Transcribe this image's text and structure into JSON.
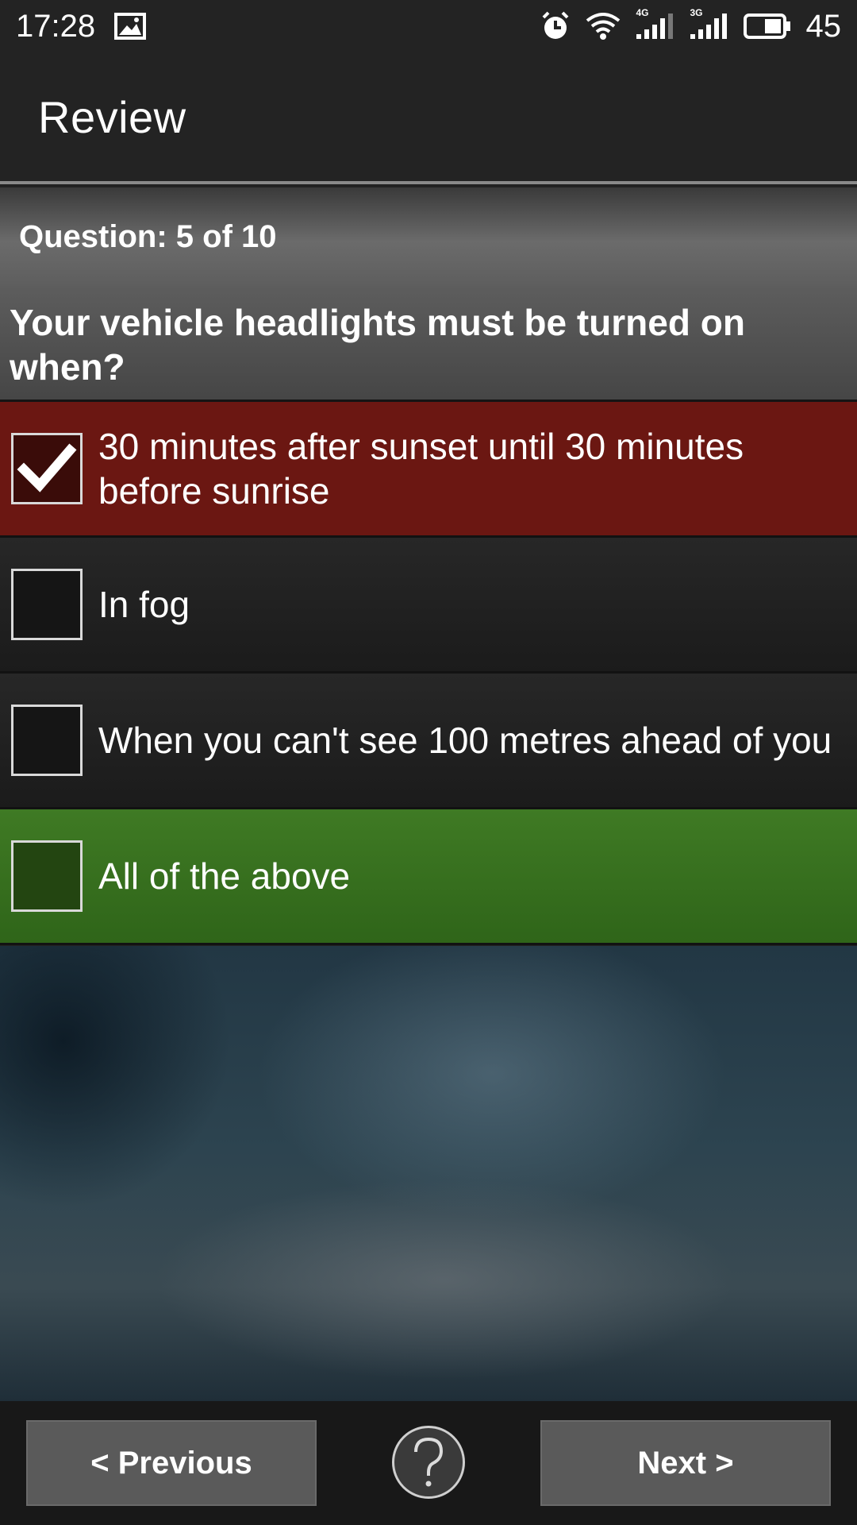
{
  "status_bar": {
    "time": "17:28",
    "network_1": "4G",
    "network_2": "3G",
    "battery": "45",
    "icons": [
      "image-icon",
      "alarm-icon",
      "wifi-icon",
      "signal-4g-icon",
      "signal-3g-icon",
      "battery-icon"
    ]
  },
  "app_bar": {
    "title": "Review"
  },
  "quiz": {
    "counter": "Question: 5 of 10",
    "question": "Your vehicle headlights must be turned on when?",
    "answers": [
      {
        "label": "30 minutes after sunset until 30 minutes before sunrise",
        "checked": true,
        "state": "selected-wrong"
      },
      {
        "label": "In fog",
        "checked": false,
        "state": "none"
      },
      {
        "label": "When you can't see 100 metres ahead of you",
        "checked": false,
        "state": "none"
      },
      {
        "label": "All of the above",
        "checked": false,
        "state": "correct"
      }
    ]
  },
  "navigation": {
    "previous_label": "< Previous",
    "next_label": "Next >",
    "help_icon": "question-mark-icon"
  },
  "colors": {
    "selected_wrong": "#6b1712",
    "correct": "#3f7a24",
    "button": "#5a5a5a"
  }
}
